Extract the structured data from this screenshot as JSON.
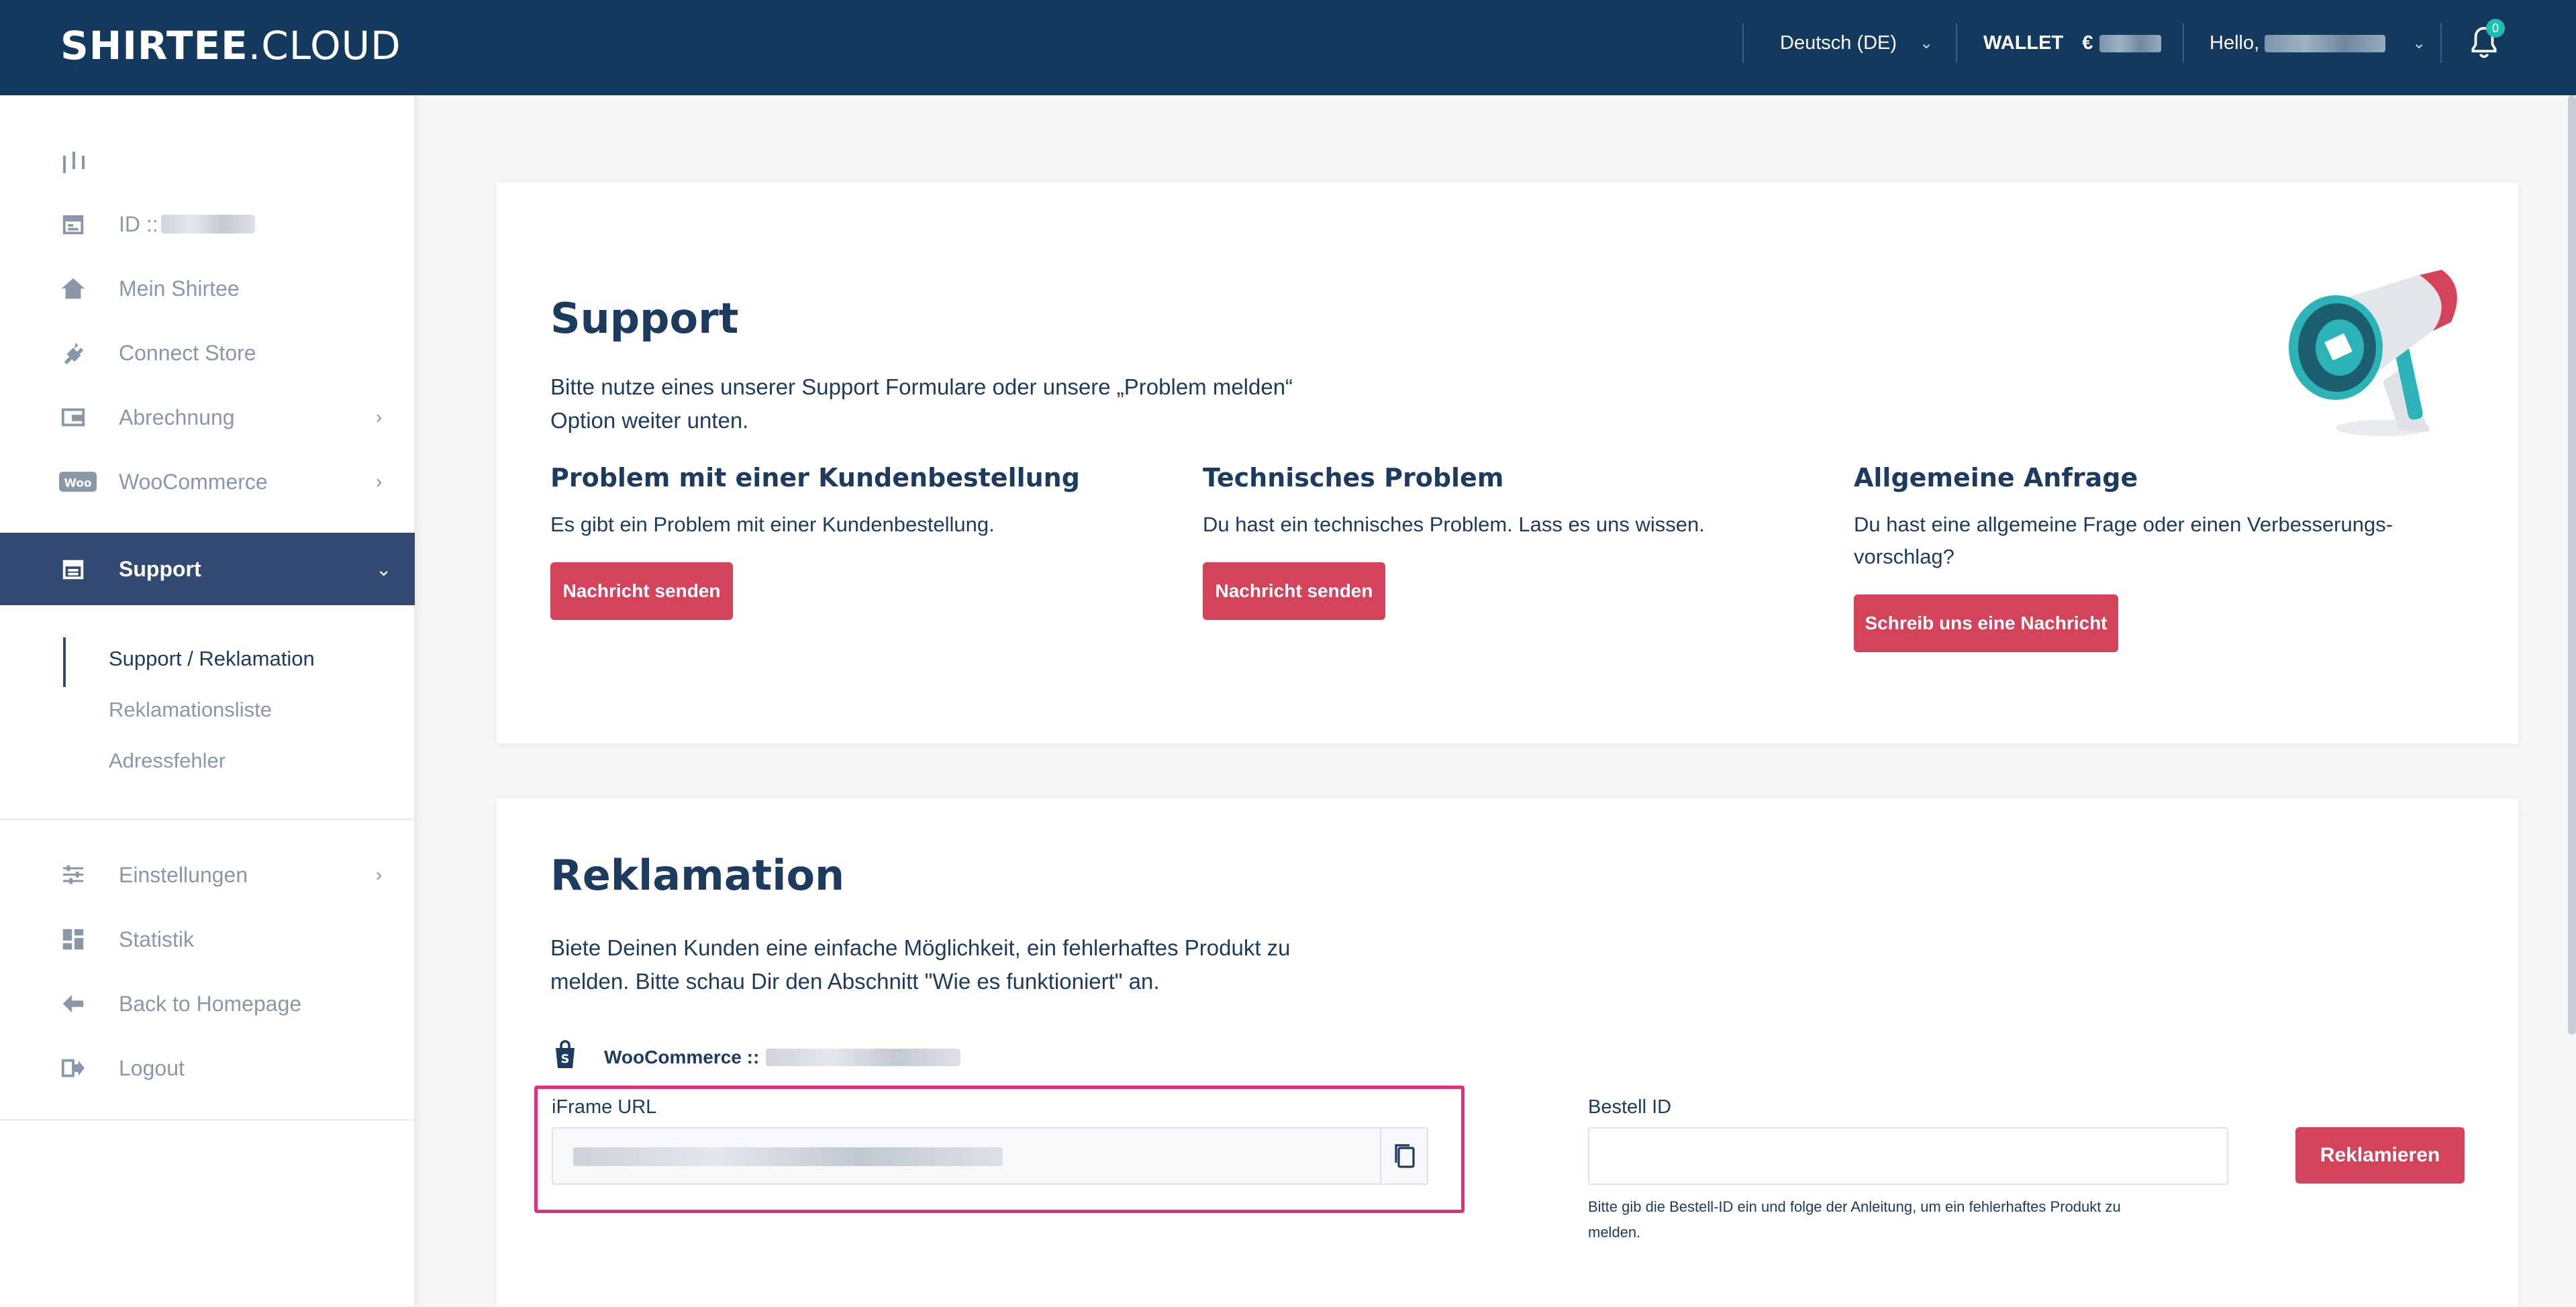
{
  "header": {
    "logo_bold": "SHIRTEE",
    "logo_light": ".CLOUD",
    "language": "Deutsch (DE)",
    "wallet_label": "WALLET",
    "wallet_currency": "€",
    "greeting": "Hello,",
    "notification_count": "0"
  },
  "sidebar": {
    "items": [
      {
        "label": "ID ::"
      },
      {
        "label": "Mein Shirtee"
      },
      {
        "label": "Connect Store"
      },
      {
        "label": "Abrechnung"
      },
      {
        "label": "WooCommerce"
      },
      {
        "label": "Support"
      },
      {
        "label": "Einstellungen"
      },
      {
        "label": "Statistik"
      },
      {
        "label": "Back to Homepage"
      },
      {
        "label": "Logout"
      }
    ],
    "sub_items": [
      {
        "label": "Support / Reklamation"
      },
      {
        "label": "Reklamationsliste"
      },
      {
        "label": "Adressfehler"
      }
    ]
  },
  "support": {
    "title": "Support",
    "description_line1": "Bitte nutze eines unserer Support Formulare oder unsere „Problem melden“",
    "description_line2": "Option weiter unten.",
    "columns": [
      {
        "title": "Problem mit einer Kundenbestellung",
        "text": "Es gibt ein Problem mit einer Kundenbestellung.",
        "button": "Nachricht senden"
      },
      {
        "title": "Technisches Problem",
        "text": "Du hast ein technisches Problem. Lass es uns wissen.",
        "button": "Nachricht senden"
      },
      {
        "title": "Allgemeine Anfrage",
        "text_line1": "Du hast eine allgemeine Frage oder einen Verbesserungs-",
        "text_line2": "vorschlag?",
        "button": "Schreib uns eine Nachricht"
      }
    ]
  },
  "reklamation": {
    "title": "Reklamation",
    "description_line1": "Biete Deinen Kunden eine einfache Möglichkeit, ein fehlerhaftes Produkt zu",
    "description_line2": "melden. Bitte schau Dir den Abschnitt \"Wie es funktioniert\" an.",
    "store_label": "WooCommerce ::",
    "iframe_label": "iFrame URL",
    "order_label": "Bestell ID",
    "order_placeholder": "",
    "button": "Reklamieren",
    "hint_line1": "Bitte gib die Bestell-ID ein und folge der Anleitung, um ein fehlerhaftes Produkt zu",
    "hint_line2": "melden."
  },
  "colors": {
    "header_bg": "#133a5e",
    "sidebar_active_bg": "#324a72",
    "button_red": "#d4435a",
    "highlight_pink": "#e0307a",
    "badge_teal": "#1fbfb0"
  },
  "icons": [
    "collapse-icon",
    "store-icon",
    "home-icon",
    "plug-icon",
    "wallet-icon",
    "woocommerce-icon",
    "support-icon",
    "sliders-icon",
    "dashboard-icon",
    "arrow-left-icon",
    "logout-icon",
    "bell-icon",
    "copy-icon",
    "shopify-bag-icon",
    "megaphone-icon"
  ]
}
